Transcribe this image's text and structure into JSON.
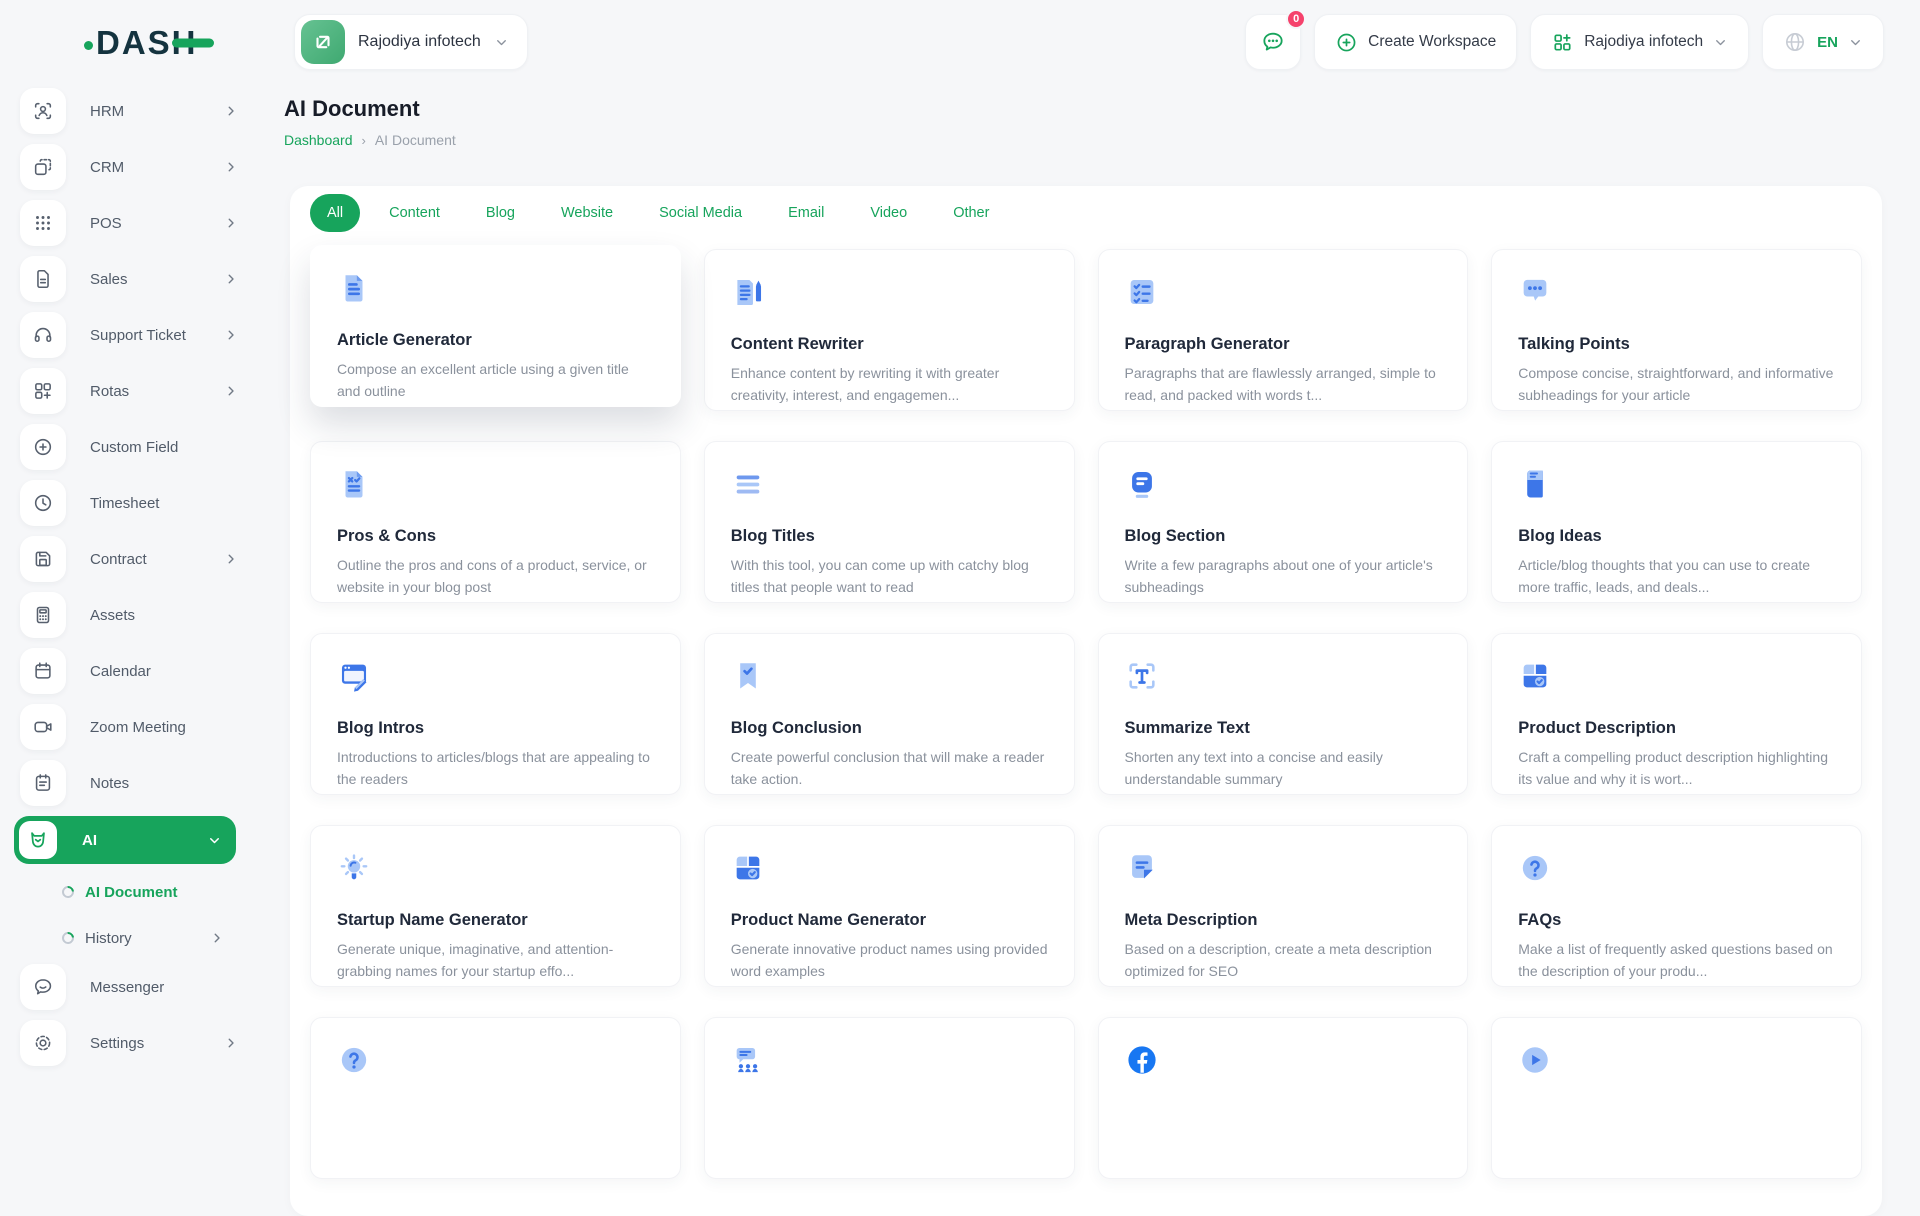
{
  "colors": {
    "accent": "#17A45C",
    "navy": "#14333F",
    "icon_primary": "#3D76E8",
    "icon_light": "#A9C7F8",
    "badge_red": "#F5426C",
    "facebook_blue": "#1877F2"
  },
  "brand": {
    "logo_text": "DASH"
  },
  "header": {
    "workspace_switcher": {
      "label": "Rajodiya infotech",
      "icon": "workspace-avatar",
      "chevron": "down"
    },
    "messages_button": {
      "icon": "chat",
      "badge_count": "0"
    },
    "create_workspace_button": {
      "label": "Create Workspace",
      "icon": "plus-circle"
    },
    "company_menu": {
      "label": "Rajodiya infotech",
      "icon": "workspace-grid",
      "chevron": "down"
    },
    "language_menu": {
      "label": "EN",
      "icon": "globe",
      "chevron": "down"
    }
  },
  "sidebar": {
    "items": [
      {
        "label": "HRM",
        "icon": "hrm",
        "chevron": "right"
      },
      {
        "label": "CRM",
        "icon": "crm",
        "chevron": "right"
      },
      {
        "label": "POS",
        "icon": "pos",
        "chevron": "right"
      },
      {
        "label": "Sales",
        "icon": "sales",
        "chevron": "right"
      },
      {
        "label": "Support Ticket",
        "icon": "support-ticket",
        "chevron": "right"
      },
      {
        "label": "Rotas",
        "icon": "rotas",
        "chevron": "right"
      },
      {
        "label": "Custom Field",
        "icon": "custom-field",
        "chevron": "none"
      },
      {
        "label": "Timesheet",
        "icon": "timesheet",
        "chevron": "none"
      },
      {
        "label": "Contract",
        "icon": "contract",
        "chevron": "right"
      },
      {
        "label": "Assets",
        "icon": "assets",
        "chevron": "none"
      },
      {
        "label": "Calendar",
        "icon": "calendar",
        "chevron": "none"
      },
      {
        "label": "Zoom Meeting",
        "icon": "zoom-meeting",
        "chevron": "none"
      },
      {
        "label": "Notes",
        "icon": "notes",
        "chevron": "none"
      },
      {
        "label": "AI",
        "icon": "ai",
        "chevron": "down",
        "active": true
      },
      {
        "label": "AI Document",
        "type": "sub",
        "active": true,
        "chevron": "none"
      },
      {
        "label": "History",
        "type": "sub",
        "chevron": "right"
      },
      {
        "label": "Messenger",
        "icon": "messenger",
        "chevron": "none"
      },
      {
        "label": "Settings",
        "icon": "settings",
        "chevron": "right"
      }
    ]
  },
  "page": {
    "title": "AI Document",
    "breadcrumb_home": "Dashboard",
    "breadcrumb_current": "AI Document"
  },
  "filter_tabs": {
    "active": "All",
    "items": [
      "All",
      "Content",
      "Blog",
      "Website",
      "Social Media",
      "Email",
      "Video",
      "Other"
    ]
  },
  "tools": [
    {
      "title": "Article Generator",
      "icon": "doc-lines",
      "elevated": true,
      "description": "Compose an excellent article using a given title and outline"
    },
    {
      "title": "Content Rewriter",
      "icon": "doc-pencil",
      "description": "Enhance content by rewriting it with greater creativity, interest, and engagemen..."
    },
    {
      "title": "Paragraph Generator",
      "icon": "checklist",
      "description": "Paragraphs that are flawlessly arranged, simple to read, and packed with words t..."
    },
    {
      "title": "Talking Points",
      "icon": "chat-dots",
      "description": "Compose concise, straightforward, and informative subheadings for your article"
    },
    {
      "title": "Pros & Cons",
      "icon": "doc-x-check",
      "description": "Outline the pros and cons of a product, service, or website in your blog post"
    },
    {
      "title": "Blog Titles",
      "icon": "text-lines",
      "description": "With this tool, you can come up with catchy blog titles that people want to read"
    },
    {
      "title": "Blog Section",
      "icon": "section-block",
      "description": "Write a few paragraphs about one of your article's subheadings"
    },
    {
      "title": "Blog Ideas",
      "icon": "notebook",
      "description": "Article/blog thoughts that you can use to create more traffic, leads, and deals..."
    },
    {
      "title": "Blog Intros",
      "icon": "window-pencil",
      "description": "Introductions to articles/blogs that are appealing to the readers"
    },
    {
      "title": "Blog Conclusion",
      "icon": "bookmark-check",
      "description": "Create powerful conclusion that will make a reader take action."
    },
    {
      "title": "Summarize Text",
      "icon": "summarize-t",
      "description": "Shorten any text into a concise and easily understandable summary"
    },
    {
      "title": "Product Description",
      "icon": "box-check",
      "description": "Craft a compelling product description highlighting its value and why it is wort..."
    },
    {
      "title": "Startup Name Generator",
      "icon": "lightbulb",
      "description": "Generate unique, imaginative, and attention-grabbing names for your startup effo..."
    },
    {
      "title": "Product Name Generator",
      "icon": "box-check",
      "description": "Generate innovative product names using provided word examples"
    },
    {
      "title": "Meta Description",
      "icon": "note-arrow",
      "description": "Based on a description, create a meta description optimized for SEO"
    },
    {
      "title": "FAQs",
      "icon": "help-circle",
      "description": "Make a list of frequently asked questions based on the description of your produ..."
    }
  ],
  "partial_tools": [
    {
      "icon": "help-circle"
    },
    {
      "icon": "reviews"
    },
    {
      "icon": "facebook"
    },
    {
      "icon": "play-circle"
    }
  ]
}
